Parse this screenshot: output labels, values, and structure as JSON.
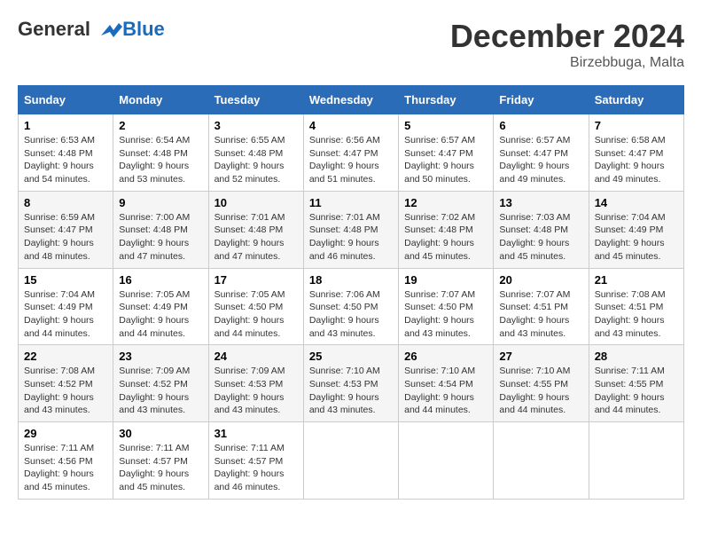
{
  "logo": {
    "line1": "General",
    "line2": "Blue"
  },
  "title": "December 2024",
  "location": "Birzebbuga, Malta",
  "days_header": [
    "Sunday",
    "Monday",
    "Tuesday",
    "Wednesday",
    "Thursday",
    "Friday",
    "Saturday"
  ],
  "weeks": [
    [
      {
        "day": "1",
        "sunrise": "6:53 AM",
        "sunset": "4:48 PM",
        "daylight": "9 hours and 54 minutes."
      },
      {
        "day": "2",
        "sunrise": "6:54 AM",
        "sunset": "4:48 PM",
        "daylight": "9 hours and 53 minutes."
      },
      {
        "day": "3",
        "sunrise": "6:55 AM",
        "sunset": "4:48 PM",
        "daylight": "9 hours and 52 minutes."
      },
      {
        "day": "4",
        "sunrise": "6:56 AM",
        "sunset": "4:47 PM",
        "daylight": "9 hours and 51 minutes."
      },
      {
        "day": "5",
        "sunrise": "6:57 AM",
        "sunset": "4:47 PM",
        "daylight": "9 hours and 50 minutes."
      },
      {
        "day": "6",
        "sunrise": "6:57 AM",
        "sunset": "4:47 PM",
        "daylight": "9 hours and 49 minutes."
      },
      {
        "day": "7",
        "sunrise": "6:58 AM",
        "sunset": "4:47 PM",
        "daylight": "9 hours and 49 minutes."
      }
    ],
    [
      {
        "day": "8",
        "sunrise": "6:59 AM",
        "sunset": "4:47 PM",
        "daylight": "9 hours and 48 minutes."
      },
      {
        "day": "9",
        "sunrise": "7:00 AM",
        "sunset": "4:48 PM",
        "daylight": "9 hours and 47 minutes."
      },
      {
        "day": "10",
        "sunrise": "7:01 AM",
        "sunset": "4:48 PM",
        "daylight": "9 hours and 47 minutes."
      },
      {
        "day": "11",
        "sunrise": "7:01 AM",
        "sunset": "4:48 PM",
        "daylight": "9 hours and 46 minutes."
      },
      {
        "day": "12",
        "sunrise": "7:02 AM",
        "sunset": "4:48 PM",
        "daylight": "9 hours and 45 minutes."
      },
      {
        "day": "13",
        "sunrise": "7:03 AM",
        "sunset": "4:48 PM",
        "daylight": "9 hours and 45 minutes."
      },
      {
        "day": "14",
        "sunrise": "7:04 AM",
        "sunset": "4:49 PM",
        "daylight": "9 hours and 45 minutes."
      }
    ],
    [
      {
        "day": "15",
        "sunrise": "7:04 AM",
        "sunset": "4:49 PM",
        "daylight": "9 hours and 44 minutes."
      },
      {
        "day": "16",
        "sunrise": "7:05 AM",
        "sunset": "4:49 PM",
        "daylight": "9 hours and 44 minutes."
      },
      {
        "day": "17",
        "sunrise": "7:05 AM",
        "sunset": "4:50 PM",
        "daylight": "9 hours and 44 minutes."
      },
      {
        "day": "18",
        "sunrise": "7:06 AM",
        "sunset": "4:50 PM",
        "daylight": "9 hours and 43 minutes."
      },
      {
        "day": "19",
        "sunrise": "7:07 AM",
        "sunset": "4:50 PM",
        "daylight": "9 hours and 43 minutes."
      },
      {
        "day": "20",
        "sunrise": "7:07 AM",
        "sunset": "4:51 PM",
        "daylight": "9 hours and 43 minutes."
      },
      {
        "day": "21",
        "sunrise": "7:08 AM",
        "sunset": "4:51 PM",
        "daylight": "9 hours and 43 minutes."
      }
    ],
    [
      {
        "day": "22",
        "sunrise": "7:08 AM",
        "sunset": "4:52 PM",
        "daylight": "9 hours and 43 minutes."
      },
      {
        "day": "23",
        "sunrise": "7:09 AM",
        "sunset": "4:52 PM",
        "daylight": "9 hours and 43 minutes."
      },
      {
        "day": "24",
        "sunrise": "7:09 AM",
        "sunset": "4:53 PM",
        "daylight": "9 hours and 43 minutes."
      },
      {
        "day": "25",
        "sunrise": "7:10 AM",
        "sunset": "4:53 PM",
        "daylight": "9 hours and 43 minutes."
      },
      {
        "day": "26",
        "sunrise": "7:10 AM",
        "sunset": "4:54 PM",
        "daylight": "9 hours and 44 minutes."
      },
      {
        "day": "27",
        "sunrise": "7:10 AM",
        "sunset": "4:55 PM",
        "daylight": "9 hours and 44 minutes."
      },
      {
        "day": "28",
        "sunrise": "7:11 AM",
        "sunset": "4:55 PM",
        "daylight": "9 hours and 44 minutes."
      }
    ],
    [
      {
        "day": "29",
        "sunrise": "7:11 AM",
        "sunset": "4:56 PM",
        "daylight": "9 hours and 45 minutes."
      },
      {
        "day": "30",
        "sunrise": "7:11 AM",
        "sunset": "4:57 PM",
        "daylight": "9 hours and 45 minutes."
      },
      {
        "day": "31",
        "sunrise": "7:11 AM",
        "sunset": "4:57 PM",
        "daylight": "9 hours and 46 minutes."
      },
      null,
      null,
      null,
      null
    ]
  ],
  "labels": {
    "sunrise": "Sunrise:",
    "sunset": "Sunset:",
    "daylight": "Daylight:"
  }
}
